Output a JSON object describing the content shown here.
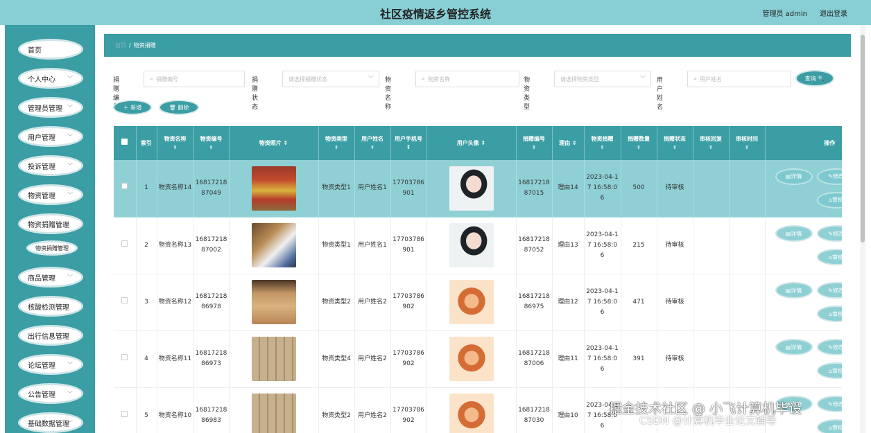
{
  "header": {
    "title": "社区疫情返乡管控系统",
    "admin_label": "管理员 admin",
    "logout_label": "退出登录"
  },
  "sidebar": {
    "items": [
      {
        "label": "首页"
      },
      {
        "label": "个人中心"
      },
      {
        "label": "管理员管理"
      },
      {
        "label": "用户管理"
      },
      {
        "label": "投诉管理"
      },
      {
        "label": "物资管理"
      },
      {
        "label": "物资捐赠管理"
      },
      {
        "label": "商品管理"
      },
      {
        "label": "核酸检测管理"
      },
      {
        "label": "出行信息管理"
      },
      {
        "label": "论坛管理"
      },
      {
        "label": "公告管理"
      },
      {
        "label": "基础数据管理"
      }
    ],
    "submenu": {
      "label": "物资捐赠管理"
    }
  },
  "breadcrumb": {
    "home": "首页",
    "current": "物资捐赠"
  },
  "search": {
    "fields": [
      {
        "label": "捐赠编号",
        "placeholder": "捐赠编号"
      },
      {
        "label": "捐赠状态",
        "placeholder": "请选择捐赠状态"
      },
      {
        "label": "物资名称",
        "placeholder": "物资名称"
      },
      {
        "label": "物资类型",
        "placeholder": "请选择物资类型"
      },
      {
        "label": "用户姓名",
        "placeholder": "用户姓名"
      }
    ],
    "query_label": "查询 🔍"
  },
  "actions": {
    "add_label": "＋ 新增",
    "delete_label": "🗑 删除"
  },
  "table": {
    "headers": [
      "索引",
      "物资名称",
      "物资编号",
      "物资照片",
      "物资类型",
      "用户姓名",
      "用户手机号",
      "用户头像",
      "捐赠编号",
      "理由",
      "物资捐赠",
      "捐赠数量",
      "捐赠状态",
      "审核回复",
      "审核时间",
      "操作"
    ],
    "sort_glyph": "⇕",
    "rows": [
      {
        "index": "1",
        "name": "物资名称14",
        "code": "1681721887049",
        "photo": "goods-a",
        "type": "物资类型1",
        "user": "用户姓名1",
        "phone": "17703786901",
        "avatar": "avatar-a",
        "donate_code": "1681721887015",
        "reason": "理由14",
        "time": "2023-04-17 16:58:06",
        "qty": "500",
        "status": "待审核",
        "reply": "",
        "audit_time": ""
      },
      {
        "index": "2",
        "name": "物资名称13",
        "code": "1681721887002",
        "photo": "goods-b",
        "type": "物资类型1",
        "user": "用户姓名1",
        "phone": "17703786901",
        "avatar": "avatar-a",
        "donate_code": "1681721887052",
        "reason": "理由13",
        "time": "2023-04-17 16:58:06",
        "qty": "215",
        "status": "待审核",
        "reply": "",
        "audit_time": ""
      },
      {
        "index": "3",
        "name": "物资名称12",
        "code": "1681721886978",
        "photo": "goods-c",
        "type": "物资类型2",
        "user": "用户姓名2",
        "phone": "17703786902",
        "avatar": "avatar-b",
        "donate_code": "1681721886975",
        "reason": "理由12",
        "time": "2023-04-17 16:58:06",
        "qty": "471",
        "status": "待审核",
        "reply": "",
        "audit_time": ""
      },
      {
        "index": "4",
        "name": "物资名称11",
        "code": "1681721886973",
        "photo": "goods-d",
        "type": "物资类型4",
        "user": "用户姓名2",
        "phone": "17703786902",
        "avatar": "avatar-b",
        "donate_code": "1681721887006",
        "reason": "理由11",
        "time": "2023-04-17 16:58:06",
        "qty": "391",
        "status": "待审核",
        "reply": "",
        "audit_time": ""
      },
      {
        "index": "5",
        "name": "物资名称10",
        "code": "1681721886983",
        "photo": "goods-d",
        "type": "物资类型2",
        "user": "用户姓名2",
        "phone": "17703786902",
        "avatar": "avatar-b",
        "donate_code": "1681721887030",
        "reason": "理由10",
        "time": "2023-04-17 16:58:06",
        "qty": "",
        "status": "",
        "reply": "",
        "audit_time": ""
      }
    ],
    "row_buttons": {
      "detail": "详情",
      "edit": "修改",
      "audit": "审核"
    }
  },
  "watermark": {
    "line1": "掘金技术社区 @ 小飞计算机毕设",
    "line2": "CSDN @计算机毕业论文辅导"
  }
}
